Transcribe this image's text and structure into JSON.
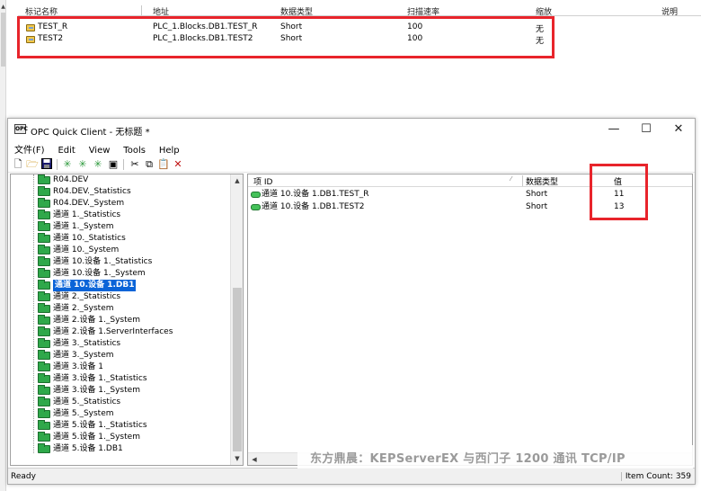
{
  "background": {
    "columns": [
      "标记名称",
      "地址",
      "数据类型",
      "扫描速率",
      "缩放",
      "说明"
    ],
    "rows": [
      {
        "name": "TEST_R",
        "address": "PLC_1.Blocks.DB1.TEST_R",
        "type": "Short",
        "rate": "100",
        "scaling": "无"
      },
      {
        "name": "TEST2",
        "address": "PLC_1.Blocks.DB1.TEST2",
        "type": "Short",
        "rate": "100",
        "scaling": "无"
      }
    ]
  },
  "window": {
    "title": "OPC Quick Client - 无标题 *",
    "app_icon_text": "OPC",
    "controls": {
      "minimize": "—",
      "maximize": "☐",
      "close": "✕"
    },
    "menu": [
      "文件(F)",
      "Edit",
      "View",
      "Tools",
      "Help"
    ],
    "toolbar_icons": [
      "new-icon",
      "open-icon",
      "save-icon",
      "new-server-icon",
      "new-group-icon",
      "new-item-icon",
      "properties-icon",
      "cut-icon",
      "copy-icon",
      "paste-icon",
      "delete-icon"
    ]
  },
  "tree": {
    "items": [
      {
        "label": "R04.DEV",
        "selected": false
      },
      {
        "label": "R04.DEV._Statistics",
        "selected": false
      },
      {
        "label": "R04.DEV._System",
        "selected": false
      },
      {
        "label": "通道 1._Statistics",
        "selected": false
      },
      {
        "label": "通道 1._System",
        "selected": false
      },
      {
        "label": "通道 10._Statistics",
        "selected": false
      },
      {
        "label": "通道 10._System",
        "selected": false
      },
      {
        "label": "通道 10.设备 1._Statistics",
        "selected": false
      },
      {
        "label": "通道 10.设备 1._System",
        "selected": false
      },
      {
        "label": "通道 10.设备 1.DB1",
        "selected": true
      },
      {
        "label": "通道 2._Statistics",
        "selected": false
      },
      {
        "label": "通道 2._System",
        "selected": false
      },
      {
        "label": "通道 2.设备 1._System",
        "selected": false
      },
      {
        "label": "通道 2.设备 1.ServerInterfaces",
        "selected": false
      },
      {
        "label": "通道 3._Statistics",
        "selected": false
      },
      {
        "label": "通道 3._System",
        "selected": false
      },
      {
        "label": "通道 3.设备 1",
        "selected": false
      },
      {
        "label": "通道 3.设备 1._Statistics",
        "selected": false
      },
      {
        "label": "通道 3.设备 1._System",
        "selected": false
      },
      {
        "label": "通道 5._Statistics",
        "selected": false
      },
      {
        "label": "通道 5._System",
        "selected": false
      },
      {
        "label": "通道 5.设备 1._Statistics",
        "selected": false
      },
      {
        "label": "通道 5.设备 1._System",
        "selected": false
      },
      {
        "label": "通道 5.设备 1.DB1",
        "selected": false
      }
    ]
  },
  "list": {
    "columns": [
      "项 ID",
      "数据类型",
      "值"
    ],
    "rows": [
      {
        "item_id": "通道 10.设备 1.DB1.TEST_R",
        "type": "Short",
        "value": "11"
      },
      {
        "item_id": "通道 10.设备 1.DB1.TEST2",
        "type": "Short",
        "value": "13"
      }
    ]
  },
  "status": {
    "left": "Ready",
    "right": "Item Count: 359"
  },
  "watermark": "东方鼎晨：KEPServerEX 与西门子 1200 通讯 TCP/IP",
  "colors": {
    "highlight": "#e8242b",
    "selection": "#0a64d8",
    "folder": "#2fa84a"
  }
}
